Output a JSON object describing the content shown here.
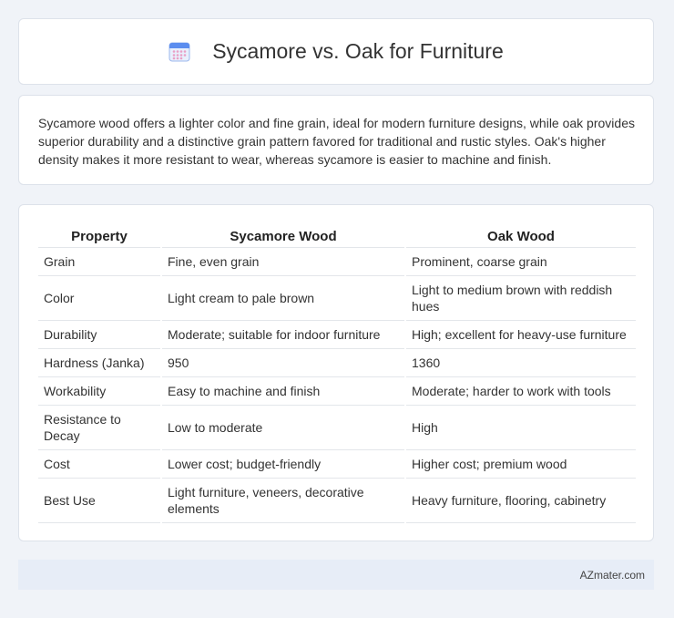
{
  "header": {
    "title": "Sycamore vs. Oak for Furniture",
    "icon": "calendar-icon"
  },
  "summary": {
    "text": "Sycamore wood offers a lighter color and fine grain, ideal for modern furniture designs, while oak provides superior durability and a distinctive grain pattern favored for traditional and rustic styles. Oak's higher density makes it more resistant to wear, whereas sycamore is easier to machine and finish."
  },
  "table": {
    "headers": [
      "Property",
      "Sycamore Wood",
      "Oak Wood"
    ],
    "rows": [
      [
        "Grain",
        "Fine, even grain",
        "Prominent, coarse grain"
      ],
      [
        "Color",
        "Light cream to pale brown",
        "Light to medium brown with reddish hues"
      ],
      [
        "Durability",
        "Moderate; suitable for indoor furniture",
        "High; excellent for heavy-use furniture"
      ],
      [
        "Hardness (Janka)",
        "950",
        "1360"
      ],
      [
        "Workability",
        "Easy to machine and finish",
        "Moderate; harder to work with tools"
      ],
      [
        "Resistance to Decay",
        "Low to moderate",
        "High"
      ],
      [
        "Cost",
        "Lower cost; budget-friendly",
        "Higher cost; premium wood"
      ],
      [
        "Best Use",
        "Light furniture, veneers, decorative elements",
        "Heavy furniture, flooring, cabinetry"
      ]
    ]
  },
  "footer": {
    "brand": "AZmater.com"
  },
  "colors": {
    "background": "#f0f3f8",
    "card": "#ffffff",
    "footer": "#e7edf7",
    "icon_blue": "#5b8def",
    "icon_pink": "#e9a0c6"
  }
}
